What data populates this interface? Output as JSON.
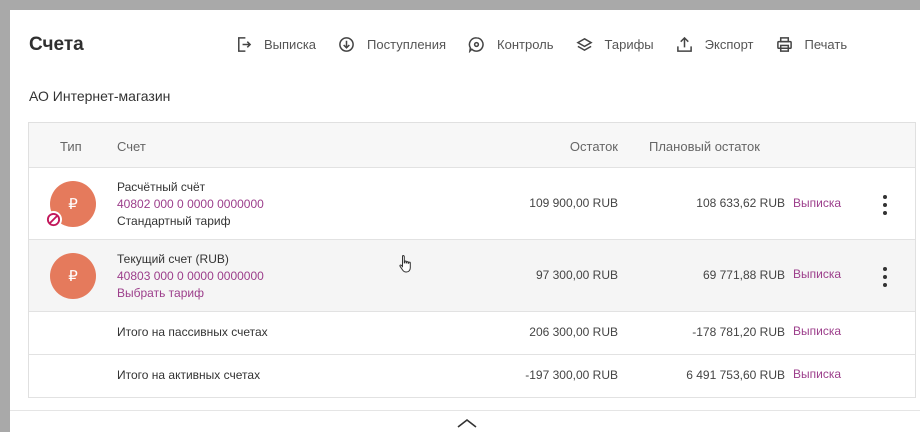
{
  "header": {
    "title": "Счета",
    "toolbar": [
      {
        "label": "Выписка",
        "icon": "statement-export-icon"
      },
      {
        "label": "Поступления",
        "icon": "incoming-icon"
      },
      {
        "label": "Контроль",
        "icon": "control-icon"
      },
      {
        "label": "Тарифы",
        "icon": "tariffs-icon"
      },
      {
        "label": "Экспорт",
        "icon": "export-icon"
      },
      {
        "label": "Печать",
        "icon": "print-icon"
      }
    ]
  },
  "company": "АО Интернет-магазин",
  "table": {
    "columns": {
      "type": "Тип",
      "account": "Счет",
      "balance": "Остаток",
      "planned": "Плановый остаток"
    },
    "accounts": [
      {
        "icon": "ruble-icon",
        "blocked": true,
        "name": "Расчётный счёт",
        "number": "40802 000 0 0000 0000000",
        "tariff": "Стандартный тариф",
        "tariff_is_link": false,
        "balance": "109 900,00 RUB",
        "planned": "108 633,62 RUB",
        "statement": "Выписка"
      },
      {
        "icon": "ruble-icon",
        "blocked": false,
        "name": "Текущий счет (RUB)",
        "number": "40803 000 0 0000 0000000",
        "tariff": "Выбрать тариф",
        "tariff_is_link": true,
        "balance": "97 300,00 RUB",
        "planned": "69 771,88 RUB",
        "statement": "Выписка"
      }
    ],
    "totals": [
      {
        "label": "Итого на пассивных счетах",
        "balance": "206 300,00 RUB",
        "planned": "-178 781,20 RUB",
        "statement": "Выписка"
      },
      {
        "label": "Итого на активных счетах",
        "balance": "-197 300,00 RUB",
        "planned": "6 491 753,60 RUB",
        "statement": "Выписка"
      }
    ]
  },
  "colors": {
    "accent": "#9c3e8b",
    "avatar": "#e57a5c",
    "block": "#c2185b"
  },
  "ruble_symbol": "₽"
}
